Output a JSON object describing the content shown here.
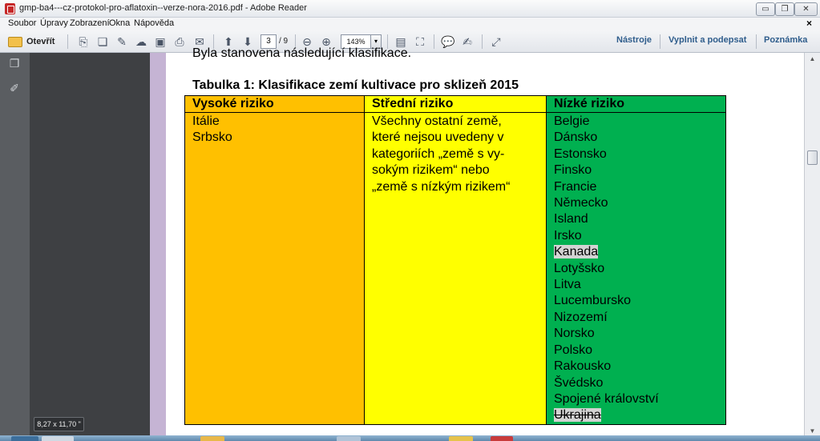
{
  "window": {
    "title": "gmp-ba4---cz-protokol-pro-aflatoxin--verze-nora-2016.pdf - Adobe Reader",
    "minimize_label": "▭",
    "restore_label": "❐",
    "close_label": "✕"
  },
  "menu": {
    "items": [
      "Soubor",
      "Úpravy",
      "Zobrazení",
      "Okna",
      "Nápověda"
    ],
    "close_doc": "×"
  },
  "toolbar": {
    "open_label": "Otevřít",
    "page_current": "3",
    "page_total": "/ 9",
    "zoom": "143%",
    "zoom_arrow": "▾",
    "tools_label": "Nástroje",
    "fill_sign_label": "Vyplnit a podepsat",
    "comment_label": "Poznámka"
  },
  "document": {
    "previous_line": "Byla stanovena následující klasifikace.",
    "caption": "Tabulka 1: Klasifikace zemí kultivace pro sklizeň 2015",
    "table": {
      "headers": [
        "Vysoké riziko",
        "Střední riziko",
        "Nízké riziko"
      ],
      "high_risk": [
        "Itálie",
        "Srbsko"
      ],
      "medium_risk": [
        "Všechny ostatní země,",
        "které nejsou uvedeny v",
        "kategoriích „země s vy-",
        "sokým rizikem“ nebo",
        "„země s nízkým rizikem“"
      ],
      "low_risk": [
        "Belgie",
        "Dánsko",
        "Estonsko",
        "Finsko",
        "Francie",
        "Německo",
        "Island",
        "Irsko",
        "Kanada",
        "Lotyšsko",
        "Litva",
        "Lucembursko",
        "Nizozemí",
        "Norsko",
        "Polsko",
        "Rakousko",
        "Švédsko",
        "Spojené království",
        "Ukrajina"
      ]
    }
  },
  "status": {
    "page_size": "8,27 x 11,70 \""
  }
}
